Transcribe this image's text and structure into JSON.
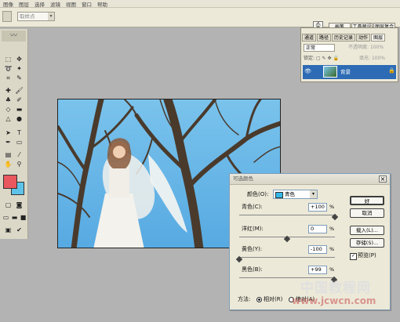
{
  "menu": [
    "图像",
    "图层",
    "选择",
    "滤镜",
    "视图",
    "窗口",
    "帮助"
  ],
  "options_bar": {
    "combo_value": "取样点",
    "well_tabs": [
      "画笔",
      "工具预设",
      "图层复合"
    ]
  },
  "layers_panel": {
    "tabs": [
      "通道",
      "路径",
      "历史记录",
      "动作",
      "图层"
    ],
    "blend_mode": "正常",
    "opacity_label": "不透明度:",
    "opacity_value": "100%",
    "lock_label": "锁定:",
    "fill_label": "填充:",
    "fill_value": "100%",
    "layer_name": "背景"
  },
  "dialog": {
    "title": "可选颜色",
    "colors_label": "颜色(O):",
    "colors_value": "青色",
    "sliders": [
      {
        "label": "青色(C):",
        "value": "+100",
        "unit": "%",
        "level": 1.0
      },
      {
        "label": "洋红(M):",
        "value": "0",
        "unit": "%",
        "level": 0.5
      },
      {
        "label": "黄色(Y):",
        "value": "-100",
        "unit": "%",
        "level": 0.0
      },
      {
        "label": "黑色(B):",
        "value": "+99",
        "unit": "%",
        "level": 0.995
      }
    ],
    "buttons": {
      "ok": "好",
      "cancel": "取消",
      "load": "载入(L)...",
      "save": "存储(S)..."
    },
    "preview_label": "预览(P)",
    "preview_checked": true,
    "method_label": "方法:",
    "method_relative": "相对(R)",
    "method_absolute": "绝对(A)",
    "method_selected": "relative"
  },
  "watermark": {
    "line1": "中国教程网",
    "line2": "www.jcwcn.com"
  },
  "colors": {
    "swatch_foreground": "#e8585e",
    "swatch_background": "#5fc3e9",
    "selection_blue": "#2d6bb4",
    "sky": "#3fa6e4"
  }
}
